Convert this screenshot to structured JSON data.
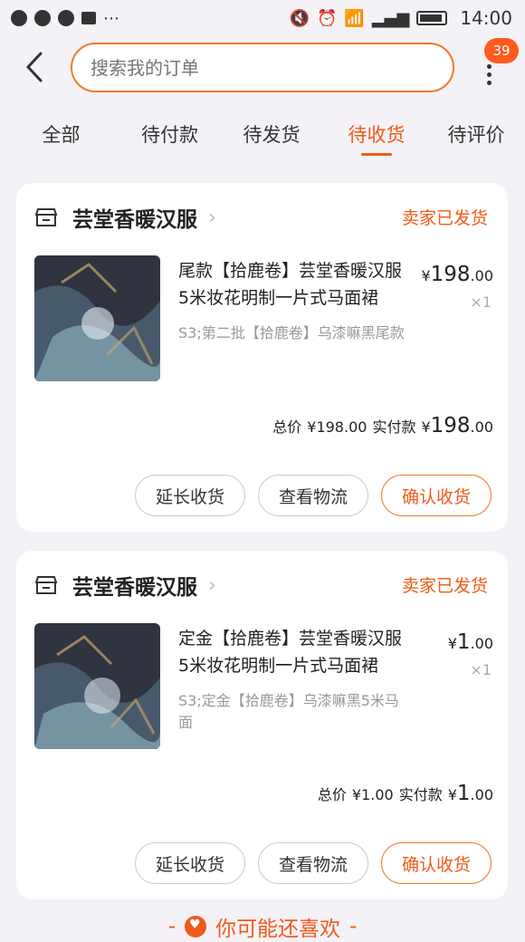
{
  "status_bar": {
    "time": "14:00"
  },
  "header": {
    "search_placeholder": "搜索我的订单",
    "badge_count": "39"
  },
  "tabs": [
    {
      "label": "全部"
    },
    {
      "label": "待付款"
    },
    {
      "label": "待发货"
    },
    {
      "label": "待收货",
      "active": true
    },
    {
      "label": "待评价"
    }
  ],
  "orders": [
    {
      "shop": "芸堂香暖汉服",
      "status": "卖家已发货",
      "title": "尾款【拾鹿卷】芸堂香暖汉服5米妆花明制一片式马面裙",
      "spec": "S3;第二批【拾鹿卷】乌漆嘛黑尾款",
      "price_cur": "¥",
      "price_int": "198",
      "price_dec": ".00",
      "qty": "×1",
      "total_label": "总价",
      "total_value": "¥198.00",
      "pay_label": "实付款",
      "pay_cur": "¥",
      "pay_int": "198",
      "pay_dec": ".00",
      "actions": [
        "延长收货",
        "查看物流",
        "确认收货"
      ]
    },
    {
      "shop": "芸堂香暖汉服",
      "status": "卖家已发货",
      "title": "定金【拾鹿卷】芸堂香暖汉服5米妆花明制一片式马面裙",
      "spec": "S3;定金【拾鹿卷】乌漆嘛黑5米马面",
      "price_cur": "¥",
      "price_int": "1",
      "price_dec": ".00",
      "qty": "×1",
      "total_label": "总价",
      "total_value": "¥1.00",
      "pay_label": "实付款",
      "pay_cur": "¥",
      "pay_int": "1",
      "pay_dec": ".00",
      "actions": [
        "延长收货",
        "查看物流",
        "确认收货"
      ]
    }
  ],
  "recommend": {
    "label": "你可能还喜欢"
  },
  "colors": {
    "accent": "#f05a1a",
    "background": "#f4f2f7"
  }
}
